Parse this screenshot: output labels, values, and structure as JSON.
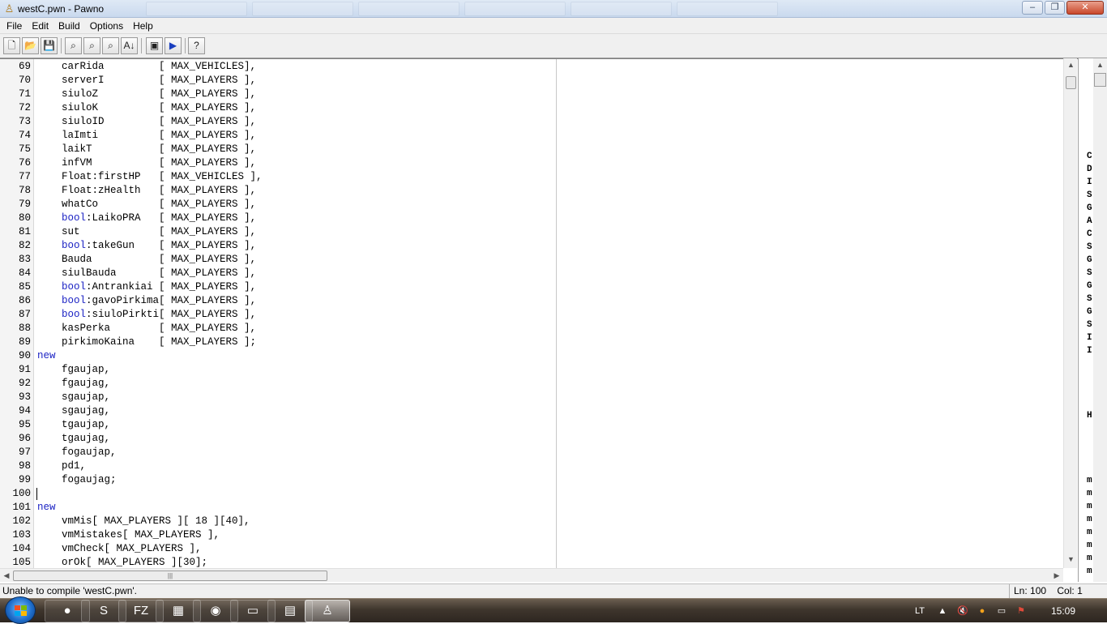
{
  "window": {
    "title": "westC.pwn - Pawno",
    "minimize": "‒",
    "maximize": "❐",
    "close": "✕"
  },
  "menu": [
    "File",
    "Edit",
    "Build",
    "Options",
    "Help"
  ],
  "toolbar": {
    "new": "🗋",
    "open": "📂",
    "save": "💾",
    "find": "⌕",
    "find_next": "⌕",
    "replace": "⌕",
    "goto": "A↓",
    "compile": "▣",
    "run": "▶",
    "help": "?"
  },
  "editor": {
    "lines": [
      {
        "n": "69",
        "kw": "",
        "t": "    carRida         [ MAX_VEHICLES],"
      },
      {
        "n": "70",
        "kw": "",
        "t": "    serverI         [ MAX_PLAYERS ],"
      },
      {
        "n": "71",
        "kw": "",
        "t": "    siuloZ          [ MAX_PLAYERS ],"
      },
      {
        "n": "72",
        "kw": "",
        "t": "    siuloK          [ MAX_PLAYERS ],"
      },
      {
        "n": "73",
        "kw": "",
        "t": "    siuloID         [ MAX_PLAYERS ],"
      },
      {
        "n": "74",
        "kw": "",
        "t": "    laImti          [ MAX_PLAYERS ],"
      },
      {
        "n": "75",
        "kw": "",
        "t": "    laikT           [ MAX_PLAYERS ],"
      },
      {
        "n": "76",
        "kw": "",
        "t": "    infVM           [ MAX_PLAYERS ],"
      },
      {
        "n": "77",
        "kw": "",
        "t": "    Float:firstHP   [ MAX_VEHICLES ],"
      },
      {
        "n": "78",
        "kw": "",
        "t": "    Float:zHealth   [ MAX_PLAYERS ],"
      },
      {
        "n": "79",
        "kw": "",
        "t": "    whatCo          [ MAX_PLAYERS ],"
      },
      {
        "n": "80",
        "kw": "bool",
        "t": ":LaikoPRA   [ MAX_PLAYERS ],"
      },
      {
        "n": "81",
        "kw": "",
        "t": "    sut             [ MAX_PLAYERS ],"
      },
      {
        "n": "82",
        "kw": "bool",
        "t": ":takeGun    [ MAX_PLAYERS ],"
      },
      {
        "n": "83",
        "kw": "",
        "t": "    Bauda           [ MAX_PLAYERS ],"
      },
      {
        "n": "84",
        "kw": "",
        "t": "    siulBauda       [ MAX_PLAYERS ],"
      },
      {
        "n": "85",
        "kw": "bool",
        "t": ":Antrankiai [ MAX_PLAYERS ],"
      },
      {
        "n": "86",
        "kw": "bool",
        "t": ":gavoPirkima[ MAX_PLAYERS ],"
      },
      {
        "n": "87",
        "kw": "bool",
        "t": ":siuloPirkti[ MAX_PLAYERS ],"
      },
      {
        "n": "88",
        "kw": "",
        "t": "    kasPerka        [ MAX_PLAYERS ],"
      },
      {
        "n": "89",
        "kw": "",
        "t": "    pirkimoKaina    [ MAX_PLAYERS ];"
      },
      {
        "n": "90",
        "kw": "new",
        "t": ""
      },
      {
        "n": "91",
        "kw": "",
        "t": "    fgaujap,"
      },
      {
        "n": "92",
        "kw": "",
        "t": "    fgaujag,"
      },
      {
        "n": "93",
        "kw": "",
        "t": "    sgaujap,"
      },
      {
        "n": "94",
        "kw": "",
        "t": "    sgaujag,"
      },
      {
        "n": "95",
        "kw": "",
        "t": "    tgaujap,"
      },
      {
        "n": "96",
        "kw": "",
        "t": "    tgaujag,"
      },
      {
        "n": "97",
        "kw": "",
        "t": "    fogaujap,"
      },
      {
        "n": "98",
        "kw": "",
        "t": "    pd1,"
      },
      {
        "n": "99",
        "kw": "",
        "t": "    fogaujag;"
      },
      {
        "n": "100",
        "kw": "",
        "t": ""
      },
      {
        "n": "101",
        "kw": "new",
        "t": ""
      },
      {
        "n": "102",
        "kw": "",
        "t": "    vmMis[ MAX_PLAYERS ][ 18 ][40],"
      },
      {
        "n": "103",
        "kw": "",
        "t": "    vmMistakes[ MAX_PLAYERS ],"
      },
      {
        "n": "104",
        "kw": "",
        "t": "    vmCheck[ MAX_PLAYERS ],"
      },
      {
        "n": "105",
        "kw": "",
        "t": "    orOk[ MAX_PLAYERS ][30];"
      }
    ],
    "caret_line": "100"
  },
  "side_letters": [
    {
      "ch": "C",
      "row": 0
    },
    {
      "ch": "D",
      "row": 1
    },
    {
      "ch": "I",
      "row": 2
    },
    {
      "ch": "S",
      "row": 3
    },
    {
      "ch": "G",
      "row": 4
    },
    {
      "ch": "A",
      "row": 5
    },
    {
      "ch": "C",
      "row": 6
    },
    {
      "ch": "S",
      "row": 7
    },
    {
      "ch": "G",
      "row": 8
    },
    {
      "ch": "S",
      "row": 9
    },
    {
      "ch": "G",
      "row": 10
    },
    {
      "ch": "S",
      "row": 11
    },
    {
      "ch": "G",
      "row": 12
    },
    {
      "ch": "S",
      "row": 13
    },
    {
      "ch": "I",
      "row": 14
    },
    {
      "ch": "I",
      "row": 15
    },
    {
      "ch": "H",
      "row": 20
    },
    {
      "ch": "m",
      "row": 25
    },
    {
      "ch": "m",
      "row": 26
    },
    {
      "ch": "m",
      "row": 27
    },
    {
      "ch": "m",
      "row": 28
    },
    {
      "ch": "m",
      "row": 29
    },
    {
      "ch": "m",
      "row": 30
    },
    {
      "ch": "m",
      "row": 31
    },
    {
      "ch": "m",
      "row": 32
    }
  ],
  "status": {
    "message": "Unable to compile 'westC.pwn'.",
    "ln": "Ln: 100",
    "col": "Col: 1"
  },
  "taskbar": {
    "apps": [
      "●",
      "S",
      "FZ",
      "▦",
      "◉",
      "▭",
      "▤",
      "♙"
    ],
    "lang": "LT",
    "clock": "15:09",
    "tray_icons": [
      "▲",
      "🔇",
      "●",
      "▭",
      "⚑"
    ]
  },
  "colors": {
    "keyword": "#1c23c4",
    "window_bg": "#f0f0f0",
    "taskbar": "#3f362d",
    "close_button": "#c9472b"
  }
}
